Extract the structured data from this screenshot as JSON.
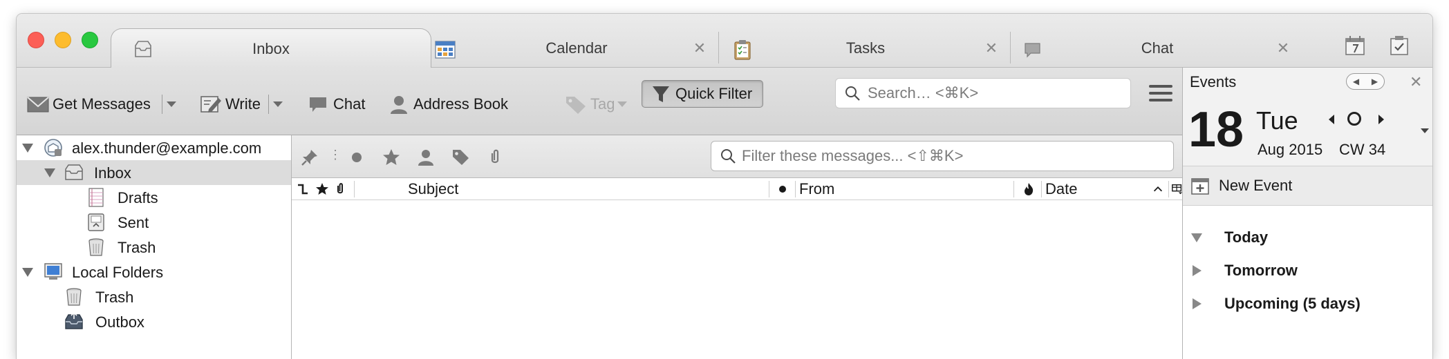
{
  "tabs": [
    {
      "label": "Inbox",
      "icon": "inbox-tab-icon",
      "active": true,
      "closable": false
    },
    {
      "label": "Calendar",
      "icon": "calendar-tab-icon",
      "active": false,
      "closable": true
    },
    {
      "label": "Tasks",
      "icon": "tasks-tab-icon",
      "active": false,
      "closable": true
    },
    {
      "label": "Chat",
      "icon": "chat-tab-icon",
      "active": false,
      "closable": true
    }
  ],
  "tab_close_glyph": "✕",
  "toolbar": {
    "get_messages": "Get Messages",
    "write": "Write",
    "chat": "Chat",
    "address_book": "Address Book",
    "tag": "Tag",
    "quick_filter": "Quick Filter",
    "search_placeholder": "Search… <⌘K>"
  },
  "folders": [
    {
      "label": "alex.thunder@example.com",
      "icon": "account-icon",
      "level": 0,
      "twisty": "open",
      "selected": false
    },
    {
      "label": "Inbox",
      "icon": "inbox-icon",
      "level": 1,
      "twisty": "open",
      "selected": true
    },
    {
      "label": "Drafts",
      "icon": "drafts-icon",
      "level": 2,
      "twisty": "none",
      "selected": false
    },
    {
      "label": "Sent",
      "icon": "sent-icon",
      "level": 2,
      "twisty": "none",
      "selected": false
    },
    {
      "label": "Trash",
      "icon": "trash-icon",
      "level": 2,
      "twisty": "none",
      "selected": false
    },
    {
      "label": "Local Folders",
      "icon": "local-folders-icon",
      "level": 0,
      "twisty": "open",
      "selected": false
    },
    {
      "label": "Trash",
      "icon": "trash-icon",
      "level": 1,
      "twisty": "none",
      "selected": false
    },
    {
      "label": "Outbox",
      "icon": "outbox-icon",
      "level": 1,
      "twisty": "none",
      "selected": false
    }
  ],
  "quick_filter_bar": {
    "filter_placeholder": "Filter these messages... <⇧⌘K>"
  },
  "columns": {
    "subject": "Subject",
    "from": "From",
    "date": "Date"
  },
  "events": {
    "title": "Events",
    "day": "18",
    "weekday": "Tue",
    "month_year": "Aug 2015",
    "calendar_week": "CW 34",
    "new_event": "New Event",
    "groups": [
      {
        "label": "Today",
        "expanded": true
      },
      {
        "label": "Tomorrow",
        "expanded": false
      },
      {
        "label": "Upcoming (5 days)",
        "expanded": false
      }
    ]
  }
}
